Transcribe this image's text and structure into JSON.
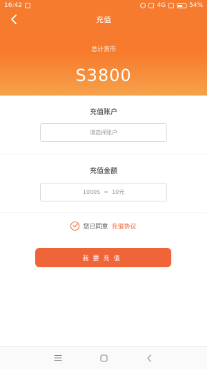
{
  "status_bar": {
    "time": "16:42",
    "network": "4G",
    "battery": "54%"
  },
  "header": {
    "title": "充值",
    "total_label": "总计货币",
    "total_amount": "S3800"
  },
  "account": {
    "title": "充值账户",
    "placeholder": "请选择账户"
  },
  "amount": {
    "title": "充值金额",
    "value": "1000S  =  10元"
  },
  "agreement": {
    "text": "您已同意",
    "link": "充值协议"
  },
  "actions": {
    "recharge_label": "我要充值"
  },
  "colors": {
    "accent": "#f0643a",
    "header_top": "#f57b2f",
    "header_bottom": "#f5a24a"
  }
}
